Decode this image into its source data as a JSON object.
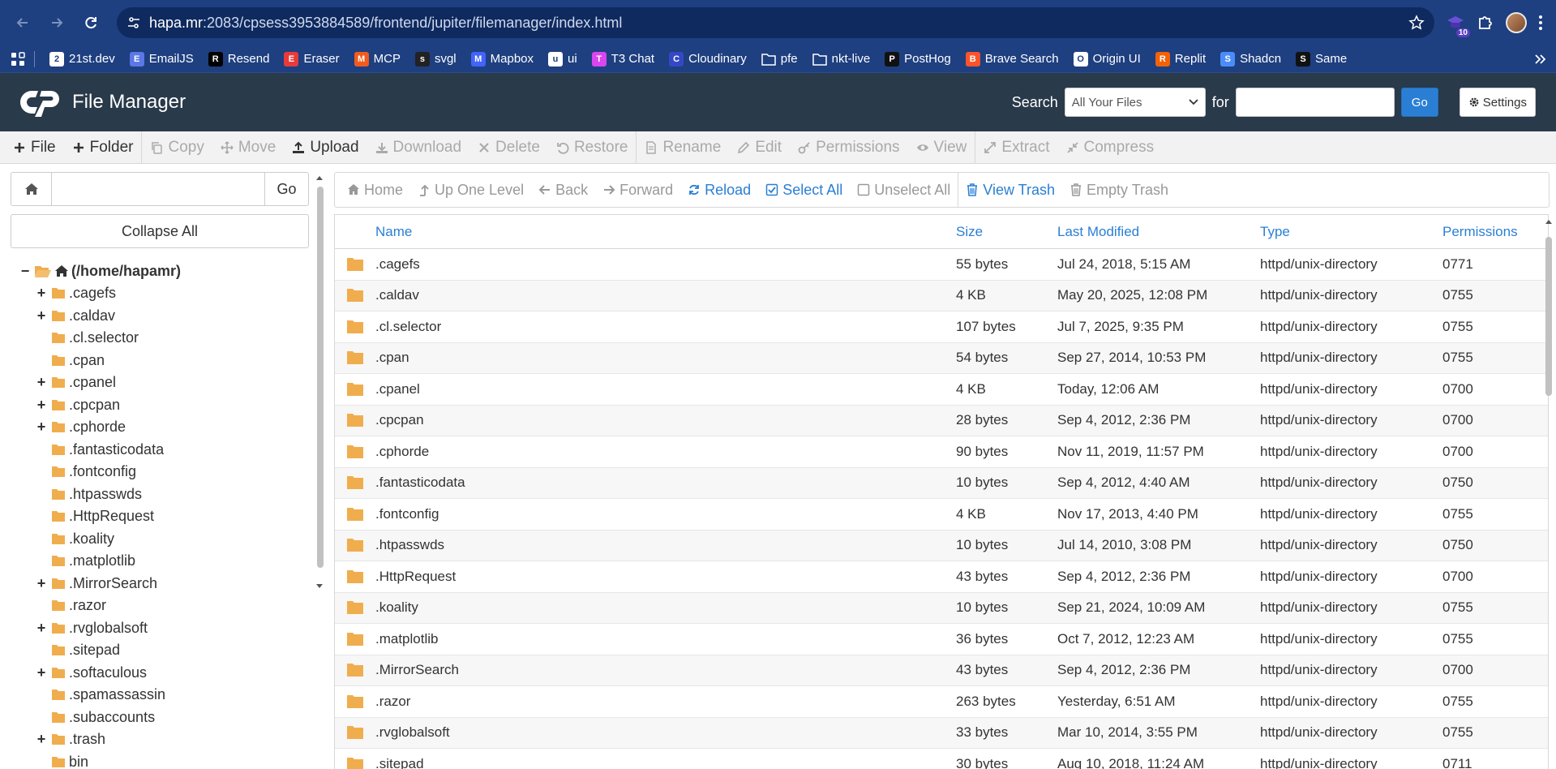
{
  "browser": {
    "url_host": "hapa.mr",
    "url_rest": ":2083/cpsess3953884589/frontend/jupiter/filemanager/index.html",
    "extension_badge": "10",
    "bookmarks": [
      {
        "label": "21st.dev",
        "icon": "21st-icon",
        "color": "#ffffff"
      },
      {
        "label": "EmailJS",
        "icon": "emailjs-icon",
        "color": "#5b78e6"
      },
      {
        "label": "Resend",
        "icon": "resend-icon",
        "color": "#000000"
      },
      {
        "label": "Eraser",
        "icon": "eraser-icon",
        "color": "#e83a3a"
      },
      {
        "label": "MCP",
        "icon": "mcp-icon",
        "color": "#f25b1d"
      },
      {
        "label": "svgl",
        "icon": "svgl-icon",
        "color": "#222222"
      },
      {
        "label": "Mapbox",
        "icon": "mapbox-icon",
        "color": "#4264fb"
      },
      {
        "label": "ui",
        "icon": "ui-icon",
        "color": "#ffffff"
      },
      {
        "label": "T3 Chat",
        "icon": "t3chat-icon",
        "color": "#d946ef"
      },
      {
        "label": "Cloudinary",
        "icon": "cloudinary-icon",
        "color": "#3448c5"
      },
      {
        "label": "pfe",
        "icon": "folder-icon",
        "color": "none"
      },
      {
        "label": "nkt-live",
        "icon": "folder-icon",
        "color": "none"
      },
      {
        "label": "PostHog",
        "icon": "posthog-icon",
        "color": "#111111"
      },
      {
        "label": "Brave Search",
        "icon": "brave-icon",
        "color": "#fb542b"
      },
      {
        "label": "Origin UI",
        "icon": "originui-icon",
        "color": "#ffffff"
      },
      {
        "label": "Replit",
        "icon": "replit-icon",
        "color": "#f26207"
      },
      {
        "label": "Shadcn",
        "icon": "shadcn-icon",
        "color": "#4b8df8"
      },
      {
        "label": "Same",
        "icon": "same-icon",
        "color": "#111111"
      }
    ]
  },
  "header": {
    "title": "File Manager",
    "search_label": "Search",
    "search_scope": "All Your Files",
    "for_label": "for",
    "go_label": "Go",
    "settings_label": "Settings"
  },
  "toolbar": {
    "items": [
      {
        "label": "File",
        "icon": "plus-icon",
        "enabled": true
      },
      {
        "label": "Folder",
        "icon": "plus-icon",
        "enabled": true
      },
      {
        "label": "Copy",
        "icon": "copy-icon",
        "enabled": false
      },
      {
        "label": "Move",
        "icon": "move-icon",
        "enabled": false
      },
      {
        "label": "Upload",
        "icon": "upload-icon",
        "enabled": true
      },
      {
        "label": "Download",
        "icon": "download-icon",
        "enabled": false
      },
      {
        "label": "Delete",
        "icon": "x-icon",
        "enabled": false
      },
      {
        "label": "Restore",
        "icon": "undo-icon",
        "enabled": false
      },
      {
        "label": "Rename",
        "icon": "file-icon",
        "enabled": false
      },
      {
        "label": "Edit",
        "icon": "pencil-icon",
        "enabled": false
      },
      {
        "label": "Permissions",
        "icon": "key-icon",
        "enabled": false
      },
      {
        "label": "View",
        "icon": "eye-icon",
        "enabled": false
      },
      {
        "label": "Extract",
        "icon": "expand-icon",
        "enabled": false
      },
      {
        "label": "Compress",
        "icon": "compress-icon",
        "enabled": false
      }
    ]
  },
  "sidebar": {
    "go_label": "Go",
    "collapse_label": "Collapse All",
    "root_label": "(/home/hapamr)",
    "items": [
      {
        "label": ".cagefs",
        "expandable": true
      },
      {
        "label": ".caldav",
        "expandable": true
      },
      {
        "label": ".cl.selector",
        "expandable": false
      },
      {
        "label": ".cpan",
        "expandable": false
      },
      {
        "label": ".cpanel",
        "expandable": true
      },
      {
        "label": ".cpcpan",
        "expandable": true
      },
      {
        "label": ".cphorde",
        "expandable": true
      },
      {
        "label": ".fantasticodata",
        "expandable": false
      },
      {
        "label": ".fontconfig",
        "expandable": false
      },
      {
        "label": ".htpasswds",
        "expandable": false
      },
      {
        "label": ".HttpRequest",
        "expandable": false
      },
      {
        "label": ".koality",
        "expandable": false
      },
      {
        "label": ".matplotlib",
        "expandable": false
      },
      {
        "label": ".MirrorSearch",
        "expandable": true
      },
      {
        "label": ".razor",
        "expandable": false
      },
      {
        "label": ".rvglobalsoft",
        "expandable": true
      },
      {
        "label": ".sitepad",
        "expandable": false
      },
      {
        "label": ".softaculous",
        "expandable": true
      },
      {
        "label": ".spamassassin",
        "expandable": false
      },
      {
        "label": ".subaccounts",
        "expandable": false
      },
      {
        "label": ".trash",
        "expandable": true
      },
      {
        "label": "bin",
        "expandable": false
      }
    ]
  },
  "subbar": {
    "items": [
      {
        "label": "Home",
        "icon": "home-icon",
        "active": false
      },
      {
        "label": "Up One Level",
        "icon": "level-up-icon",
        "active": false
      },
      {
        "label": "Back",
        "icon": "arrow-left-icon",
        "active": false
      },
      {
        "label": "Forward",
        "icon": "arrow-right-icon",
        "active": false
      },
      {
        "label": "Reload",
        "icon": "refresh-icon",
        "active": true
      },
      {
        "label": "Select All",
        "icon": "checkbox-checked-icon",
        "active": true
      },
      {
        "label": "Unselect All",
        "icon": "checkbox-empty-icon",
        "active": false
      },
      {
        "label": "View Trash",
        "icon": "trash-icon",
        "active": true
      },
      {
        "label": "Empty Trash",
        "icon": "trash-icon",
        "active": false
      }
    ]
  },
  "table": {
    "columns": {
      "name": "Name",
      "size": "Size",
      "modified": "Last Modified",
      "type": "Type",
      "permissions": "Permissions"
    },
    "rows": [
      {
        "name": ".cagefs",
        "size": "55 bytes",
        "modified": "Jul 24, 2018, 5:15 AM",
        "type": "httpd/unix-directory",
        "perm": "0771"
      },
      {
        "name": ".caldav",
        "size": "4 KB",
        "modified": "May 20, 2025, 12:08 PM",
        "type": "httpd/unix-directory",
        "perm": "0755"
      },
      {
        "name": ".cl.selector",
        "size": "107 bytes",
        "modified": "Jul 7, 2025, 9:35 PM",
        "type": "httpd/unix-directory",
        "perm": "0755"
      },
      {
        "name": ".cpan",
        "size": "54 bytes",
        "modified": "Sep 27, 2014, 10:53 PM",
        "type": "httpd/unix-directory",
        "perm": "0755"
      },
      {
        "name": ".cpanel",
        "size": "4 KB",
        "modified": "Today, 12:06 AM",
        "type": "httpd/unix-directory",
        "perm": "0700"
      },
      {
        "name": ".cpcpan",
        "size": "28 bytes",
        "modified": "Sep 4, 2012, 2:36 PM",
        "type": "httpd/unix-directory",
        "perm": "0700"
      },
      {
        "name": ".cphorde",
        "size": "90 bytes",
        "modified": "Nov 11, 2019, 11:57 PM",
        "type": "httpd/unix-directory",
        "perm": "0700"
      },
      {
        "name": ".fantasticodata",
        "size": "10 bytes",
        "modified": "Sep 4, 2012, 4:40 AM",
        "type": "httpd/unix-directory",
        "perm": "0750"
      },
      {
        "name": ".fontconfig",
        "size": "4 KB",
        "modified": "Nov 17, 2013, 4:40 PM",
        "type": "httpd/unix-directory",
        "perm": "0755"
      },
      {
        "name": ".htpasswds",
        "size": "10 bytes",
        "modified": "Jul 14, 2010, 3:08 PM",
        "type": "httpd/unix-directory",
        "perm": "0750"
      },
      {
        "name": ".HttpRequest",
        "size": "43 bytes",
        "modified": "Sep 4, 2012, 2:36 PM",
        "type": "httpd/unix-directory",
        "perm": "0700"
      },
      {
        "name": ".koality",
        "size": "10 bytes",
        "modified": "Sep 21, 2024, 10:09 AM",
        "type": "httpd/unix-directory",
        "perm": "0755"
      },
      {
        "name": ".matplotlib",
        "size": "36 bytes",
        "modified": "Oct 7, 2012, 12:23 AM",
        "type": "httpd/unix-directory",
        "perm": "0755"
      },
      {
        "name": ".MirrorSearch",
        "size": "43 bytes",
        "modified": "Sep 4, 2012, 2:36 PM",
        "type": "httpd/unix-directory",
        "perm": "0700"
      },
      {
        "name": ".razor",
        "size": "263 bytes",
        "modified": "Yesterday, 6:51 AM",
        "type": "httpd/unix-directory",
        "perm": "0755"
      },
      {
        "name": ".rvglobalsoft",
        "size": "33 bytes",
        "modified": "Mar 10, 2014, 3:55 PM",
        "type": "httpd/unix-directory",
        "perm": "0755"
      },
      {
        "name": ".sitepad",
        "size": "30 bytes",
        "modified": "Aug 10, 2018, 11:24 AM",
        "type": "httpd/unix-directory",
        "perm": "0711"
      }
    ]
  },
  "colors": {
    "browser_bg": "#1e3f80",
    "cpanel_header": "#293a4a",
    "link_blue": "#2a7fd4",
    "folder_yellow": "#f0ad4e"
  }
}
